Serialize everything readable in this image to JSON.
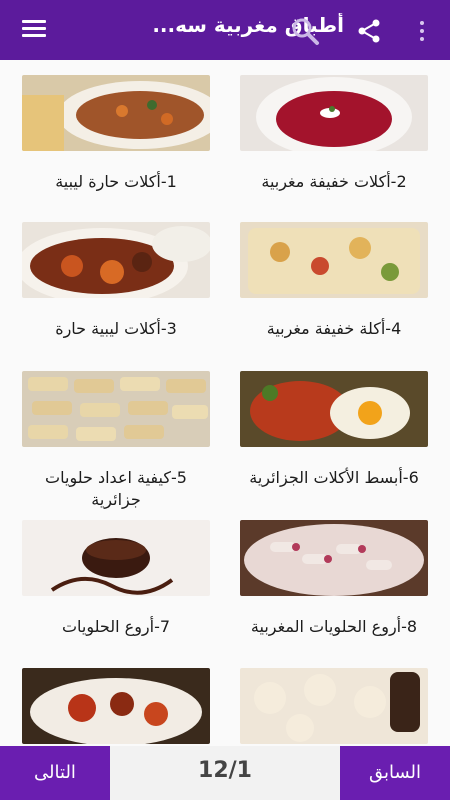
{
  "appbar": {
    "title": "أطباق مغربية سه...",
    "icons": {
      "menu": "menu-icon",
      "search": "search-icon",
      "share": "share-icon",
      "more": "more-vert-icon"
    }
  },
  "items": [
    {
      "label": "1-أكلات حارة ليبية",
      "image": "soup-bowl"
    },
    {
      "label": "2-أكلات خفيفة مغربية",
      "image": "beet-soup"
    },
    {
      "label": "3-أكلات ليبية حارة",
      "image": "meat-stew"
    },
    {
      "label": "4-أكلة خفيفة مغربية",
      "image": "gratin"
    },
    {
      "label": "5-كيفية اعداد حلويات جزائرية",
      "image": "biscotti"
    },
    {
      "label": "6-أبسط الأكلات الجزائرية",
      "image": "egg-tomato"
    },
    {
      "label": "7-أروع الحلويات",
      "image": "chocolate-dessert"
    },
    {
      "label": "8-أروع الحلويات المغربية",
      "image": "cookie-rolls"
    },
    {
      "label": "",
      "image": "roasted-dish"
    },
    {
      "label": "",
      "image": "pastries"
    }
  ],
  "pager": {
    "next_label": "التالى",
    "prev_label": "السابق",
    "page_indicator": "12/1"
  }
}
